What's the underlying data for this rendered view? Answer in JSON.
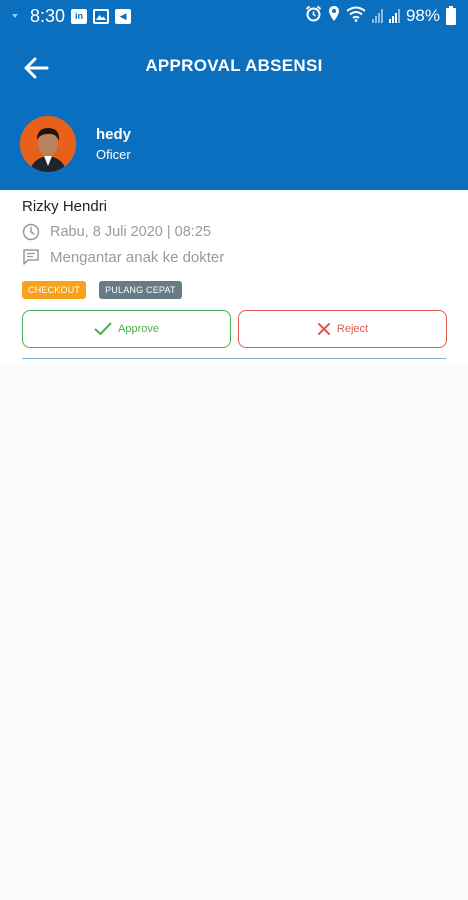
{
  "status_bar": {
    "time": "8:30",
    "app_icons": [
      "linkedin-icon",
      "gallery-icon",
      "message-icon"
    ],
    "linkedin_glyph": "in",
    "message_glyph": "◀",
    "battery_percent": "98%"
  },
  "app_bar": {
    "title": "APPROVAL ABSENSI",
    "back_icon": "arrow-left-icon"
  },
  "profile": {
    "name": "hedy",
    "role": "Oficer"
  },
  "request": {
    "employee_name": "Rizky Hendri",
    "datetime": "Rabu, 8 Juli 2020 | 08:25",
    "note": "Mengantar anak ke dokter",
    "badges": [
      {
        "label": "CHECKOUT",
        "color": "#f7a21b"
      },
      {
        "label": "PULANG CEPAT",
        "color": "#667b86"
      }
    ],
    "approve_label": "Approve",
    "reject_label": "Reject"
  },
  "colors": {
    "primary": "#0a6fbf",
    "approve": "#4caf50",
    "reject": "#e05a4e"
  }
}
